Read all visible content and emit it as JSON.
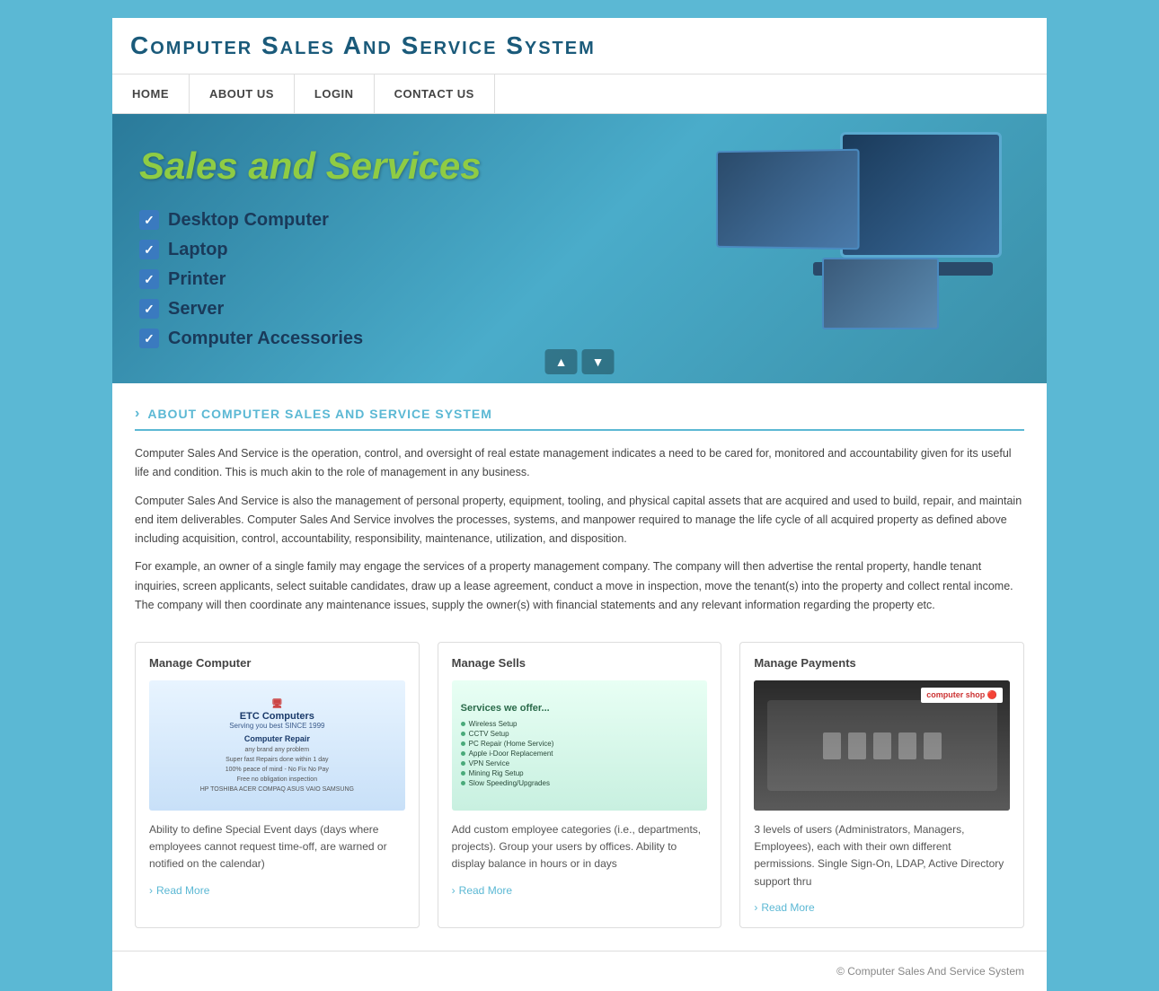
{
  "site": {
    "title": "Computer Sales And Service System",
    "footer_text": "© Computer Sales And Service System"
  },
  "nav": {
    "items": [
      {
        "id": "home",
        "label": "HOME"
      },
      {
        "id": "about",
        "label": "ABOUT US"
      },
      {
        "id": "login",
        "label": "LOGIN"
      },
      {
        "id": "contact",
        "label": "CONTACT US"
      }
    ]
  },
  "banner": {
    "heading": "Sales and Services",
    "items": [
      "Desktop Computer",
      "Laptop",
      "Printer",
      "Server",
      "Computer Accessories"
    ],
    "prev_label": "▲",
    "next_label": "▼"
  },
  "about": {
    "heading": "ABOUT COMPUTER SALES AND SERVICE SYSTEM",
    "paragraphs": [
      "Computer Sales And Service is the operation, control, and oversight of real estate management indicates a need to be cared for, monitored and accountability given for its useful life and condition. This is much akin to the role of management in any business.",
      "Computer Sales And Service is also the management of personal property, equipment, tooling, and physical capital assets that are acquired and used to build, repair, and maintain end item deliverables. Computer Sales And Service involves the processes, systems, and manpower required to manage the life cycle of all acquired property as defined above including acquisition, control, accountability, responsibility, maintenance, utilization, and disposition.",
      "For example, an owner of a single family may engage the services of a property management company. The company will then advertise the rental property, handle tenant inquiries, screen applicants, select suitable candidates, draw up a lease agreement, conduct a move in inspection, move the tenant(s) into the property and collect rental income. The company will then coordinate any maintenance issues, supply the owner(s) with financial statements and any relevant information regarding the property etc."
    ]
  },
  "cards": [
    {
      "id": "manage-computer",
      "title": "Manage Computer",
      "img_type": "computer",
      "img_alt": "ETC Computers - Computer Repair",
      "company_name": "ETC Computers",
      "company_sub": "Serving you best SINCE 1999",
      "service_name": "Computer Repair",
      "service_sub": "any brand any problem",
      "details1": "Super fast Repairs done within 1 day",
      "details2": "100% peace of mind - No Fix No Pay",
      "details3": "Free no obligation inspection",
      "brands": "HP TOSHIBA ACER COMPAQ ASUS VAIO SAMSUNG",
      "description": "Ability to define Special Event days (days where employees cannot request time-off, are warned or notified on the calendar)",
      "read_more": "Read More"
    },
    {
      "id": "manage-sells",
      "title": "Manage Sells",
      "img_type": "services",
      "img_alt": "Services we offer",
      "services_list": [
        "Wireless Setup",
        "CCTV Setup",
        "PC Repair (Home Service)",
        "Apple i-Door Replacement",
        "VPN Service",
        "Mining Rig Setup",
        "Slow Speeding/Upgrades"
      ],
      "description": "Add custom employee categories (i.e., departments, projects). Group your users by offices. Ability to display balance in hours or in days",
      "read_more": "Read More"
    },
    {
      "id": "manage-payments",
      "title": "Manage Payments",
      "img_type": "payments",
      "img_alt": "computer shop",
      "shop_text": "computer shop",
      "description": "3 levels of users (Administrators, Managers, Employees), each with their own different permissions. Single Sign-On, LDAP, Active Directory support thru",
      "read_more": "Read More"
    }
  ]
}
